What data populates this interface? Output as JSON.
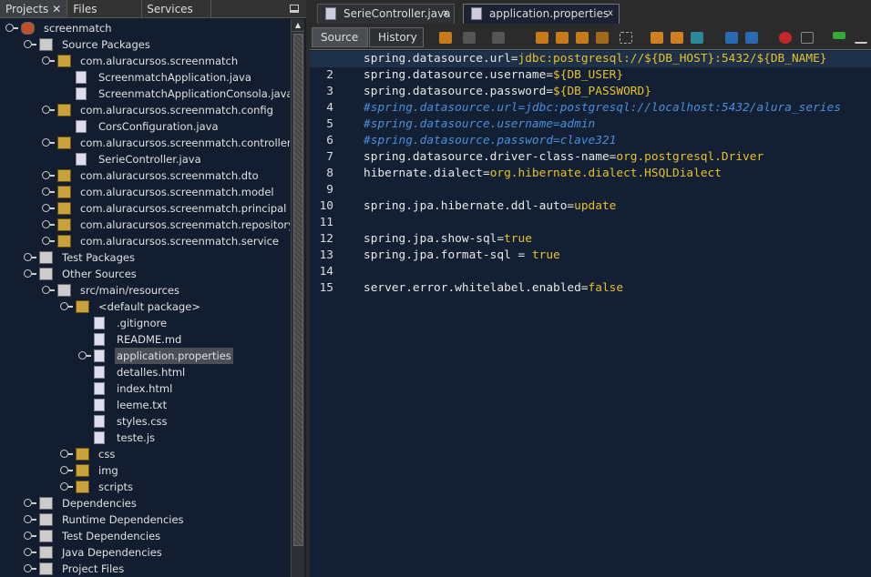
{
  "left_panel": {
    "tabs": [
      "Projects",
      "Files",
      "Services"
    ],
    "close_label": "✕"
  },
  "tree": [
    {
      "label": "screenmatch",
      "level": 0,
      "toggle": "expanded",
      "icon": "project-icon"
    },
    {
      "label": "Source Packages",
      "level": 1,
      "toggle": "expanded",
      "icon": "source-folder-icon"
    },
    {
      "label": "com.aluracursos.screenmatch",
      "level": 2,
      "toggle": "expanded",
      "icon": "package-icon"
    },
    {
      "label": "ScreenmatchApplication.java",
      "level": 3,
      "toggle": "none",
      "icon": "java-main-icon"
    },
    {
      "label": "ScreenmatchApplicationConsola.java",
      "level": 3,
      "toggle": "none",
      "icon": "java-file-icon"
    },
    {
      "label": "com.aluracursos.screenmatch.config",
      "level": 2,
      "toggle": "expanded",
      "icon": "package-icon"
    },
    {
      "label": "CorsConfiguration.java",
      "level": 3,
      "toggle": "none",
      "icon": "java-file-icon"
    },
    {
      "label": "com.aluracursos.screenmatch.controller",
      "level": 2,
      "toggle": "expanded",
      "icon": "package-icon"
    },
    {
      "label": "SerieController.java",
      "level": 3,
      "toggle": "none",
      "icon": "java-file-icon"
    },
    {
      "label": "com.aluracursos.screenmatch.dto",
      "level": 2,
      "toggle": "collapsed",
      "icon": "package-icon"
    },
    {
      "label": "com.aluracursos.screenmatch.model",
      "level": 2,
      "toggle": "collapsed",
      "icon": "package-icon"
    },
    {
      "label": "com.aluracursos.screenmatch.principal",
      "level": 2,
      "toggle": "collapsed",
      "icon": "package-icon"
    },
    {
      "label": "com.aluracursos.screenmatch.repository",
      "level": 2,
      "toggle": "collapsed",
      "icon": "package-icon"
    },
    {
      "label": "com.aluracursos.screenmatch.service",
      "level": 2,
      "toggle": "collapsed",
      "icon": "package-icon"
    },
    {
      "label": "Test Packages",
      "level": 1,
      "toggle": "collapsed",
      "icon": "folder-icon"
    },
    {
      "label": "Other Sources",
      "level": 1,
      "toggle": "expanded",
      "icon": "folder-icon"
    },
    {
      "label": "src/main/resources",
      "level": 2,
      "toggle": "expanded",
      "icon": "resource-folder-icon"
    },
    {
      "label": "<default package>",
      "level": 3,
      "toggle": "expanded",
      "icon": "package-icon"
    },
    {
      "label": ".gitignore",
      "level": 4,
      "toggle": "none",
      "icon": "file-icon"
    },
    {
      "label": "README.md",
      "level": 4,
      "toggle": "none",
      "icon": "markdown-icon"
    },
    {
      "label": "application.properties",
      "level": 4,
      "toggle": "collapsed",
      "icon": "properties-icon",
      "selected": true
    },
    {
      "label": "detalles.html",
      "level": 4,
      "toggle": "none",
      "icon": "html-icon"
    },
    {
      "label": "index.html",
      "level": 4,
      "toggle": "none",
      "icon": "html-icon"
    },
    {
      "label": "leeme.txt",
      "level": 4,
      "toggle": "none",
      "icon": "file-icon"
    },
    {
      "label": "styles.css",
      "level": 4,
      "toggle": "none",
      "icon": "css-icon"
    },
    {
      "label": "teste.js",
      "level": 4,
      "toggle": "none",
      "icon": "js-icon"
    },
    {
      "label": "css",
      "level": 3,
      "toggle": "collapsed",
      "icon": "package-icon"
    },
    {
      "label": "img",
      "level": 3,
      "toggle": "collapsed",
      "icon": "package-icon"
    },
    {
      "label": "scripts",
      "level": 3,
      "toggle": "collapsed",
      "icon": "package-icon"
    },
    {
      "label": "Dependencies",
      "level": 1,
      "toggle": "collapsed",
      "icon": "library-icon"
    },
    {
      "label": "Runtime Dependencies",
      "level": 1,
      "toggle": "collapsed",
      "icon": "library-icon"
    },
    {
      "label": "Test Dependencies",
      "level": 1,
      "toggle": "collapsed",
      "icon": "library-icon"
    },
    {
      "label": "Java Dependencies",
      "level": 1,
      "toggle": "collapsed",
      "icon": "library-icon"
    },
    {
      "label": "Project Files",
      "level": 1,
      "toggle": "collapsed",
      "icon": "library-icon"
    }
  ],
  "editor": {
    "tabs": [
      {
        "label": "SerieController.java",
        "active": false
      },
      {
        "label": "application.properties",
        "active": true
      }
    ],
    "close_label": "x",
    "source_label": "Source",
    "history_label": "History",
    "lines": [
      {
        "k": "spring.datasource.url=",
        "v": "jdbc:postgresql://${DB_HOST}:5432/${DB_NAME}"
      },
      {
        "k": "spring.datasource.username=",
        "v": "${DB_USER}"
      },
      {
        "k": "spring.datasource.password=",
        "v": "${DB_PASSWORD}"
      },
      {
        "c": "#spring.datasource.url=jdbc:postgresql://localhost:5432/alura_series"
      },
      {
        "c": "#spring.datasource.username=admin"
      },
      {
        "c": "#spring.datasource.password=clave321"
      },
      {
        "k": "spring.datasource.driver-class-name=",
        "v": "org.postgresql.Driver"
      },
      {
        "k": "hibernate.dialect=",
        "v": "org.hibernate.dialect.HSQLDialect"
      },
      {},
      {
        "k": "spring.jpa.hibernate.ddl-auto=",
        "v": "update"
      },
      {},
      {
        "k": "spring.jpa.show-sql=",
        "v": "true"
      },
      {
        "k": "spring.jpa.format-sql = ",
        "v": "true"
      },
      {},
      {
        "k": "server.error.whitelabel.enabled=",
        "v": "false"
      }
    ]
  },
  "colors": {
    "value": "#e6c229",
    "comment": "#4a8fd9",
    "background": "#131f33"
  }
}
